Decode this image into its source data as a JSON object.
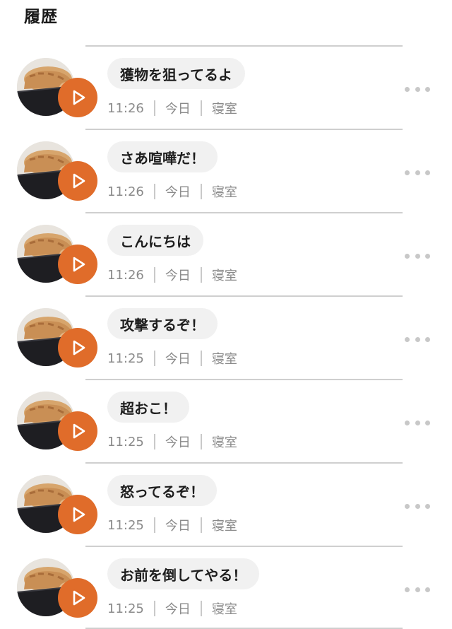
{
  "page": {
    "title": "履歴"
  },
  "history": {
    "items": [
      {
        "message": "獲物を狙ってるよ",
        "time": "11:26",
        "day": "今日",
        "room": "寝室"
      },
      {
        "message": "さあ喧嘩だ！",
        "time": "11:26",
        "day": "今日",
        "room": "寝室"
      },
      {
        "message": "こんにちは",
        "time": "11:26",
        "day": "今日",
        "room": "寝室"
      },
      {
        "message": "攻撃するぞ！",
        "time": "11:25",
        "day": "今日",
        "room": "寝室"
      },
      {
        "message": "超おこ！",
        "time": "11:25",
        "day": "今日",
        "room": "寝室"
      },
      {
        "message": "怒ってるぞ！",
        "time": "11:25",
        "day": "今日",
        "room": "寝室"
      },
      {
        "message": "お前を倒してやる！",
        "time": "11:25",
        "day": "今日",
        "room": "寝室"
      }
    ]
  },
  "icons": {
    "play": "play-icon",
    "more": "more-dots-icon",
    "avatar": "cat-photo"
  },
  "colors": {
    "accent": "#e06c2a",
    "bubble": "#f1f1f1",
    "meta_text": "#8a8a8a",
    "divider": "#cfcfcf"
  }
}
